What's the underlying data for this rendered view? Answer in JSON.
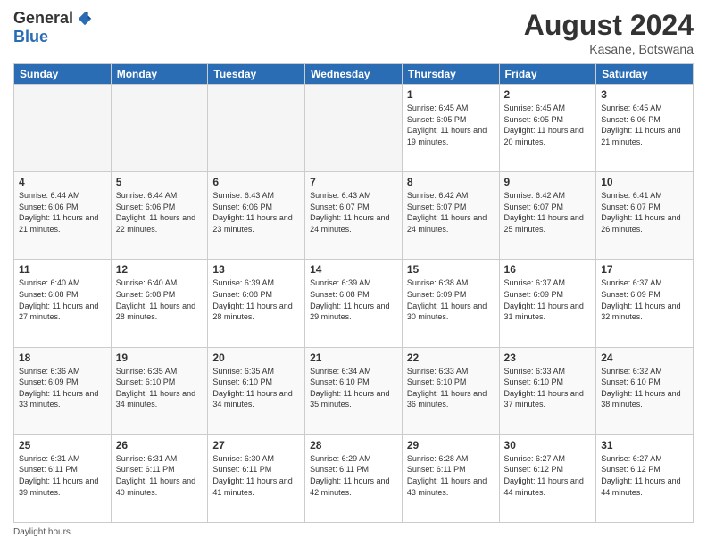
{
  "logo": {
    "general": "General",
    "blue": "Blue"
  },
  "title": "August 2024",
  "subtitle": "Kasane, Botswana",
  "days_of_week": [
    "Sunday",
    "Monday",
    "Tuesday",
    "Wednesday",
    "Thursday",
    "Friday",
    "Saturday"
  ],
  "footer": {
    "daylight_hours": "Daylight hours"
  },
  "weeks": [
    [
      {
        "day": "",
        "sunrise": "",
        "sunset": "",
        "daylight": "",
        "empty": true
      },
      {
        "day": "",
        "sunrise": "",
        "sunset": "",
        "daylight": "",
        "empty": true
      },
      {
        "day": "",
        "sunrise": "",
        "sunset": "",
        "daylight": "",
        "empty": true
      },
      {
        "day": "",
        "sunrise": "",
        "sunset": "",
        "daylight": "",
        "empty": true
      },
      {
        "day": "1",
        "sunrise": "Sunrise: 6:45 AM",
        "sunset": "Sunset: 6:05 PM",
        "daylight": "Daylight: 11 hours and 19 minutes.",
        "empty": false
      },
      {
        "day": "2",
        "sunrise": "Sunrise: 6:45 AM",
        "sunset": "Sunset: 6:05 PM",
        "daylight": "Daylight: 11 hours and 20 minutes.",
        "empty": false
      },
      {
        "day": "3",
        "sunrise": "Sunrise: 6:45 AM",
        "sunset": "Sunset: 6:06 PM",
        "daylight": "Daylight: 11 hours and 21 minutes.",
        "empty": false
      }
    ],
    [
      {
        "day": "4",
        "sunrise": "Sunrise: 6:44 AM",
        "sunset": "Sunset: 6:06 PM",
        "daylight": "Daylight: 11 hours and 21 minutes.",
        "empty": false
      },
      {
        "day": "5",
        "sunrise": "Sunrise: 6:44 AM",
        "sunset": "Sunset: 6:06 PM",
        "daylight": "Daylight: 11 hours and 22 minutes.",
        "empty": false
      },
      {
        "day": "6",
        "sunrise": "Sunrise: 6:43 AM",
        "sunset": "Sunset: 6:06 PM",
        "daylight": "Daylight: 11 hours and 23 minutes.",
        "empty": false
      },
      {
        "day": "7",
        "sunrise": "Sunrise: 6:43 AM",
        "sunset": "Sunset: 6:07 PM",
        "daylight": "Daylight: 11 hours and 24 minutes.",
        "empty": false
      },
      {
        "day": "8",
        "sunrise": "Sunrise: 6:42 AM",
        "sunset": "Sunset: 6:07 PM",
        "daylight": "Daylight: 11 hours and 24 minutes.",
        "empty": false
      },
      {
        "day": "9",
        "sunrise": "Sunrise: 6:42 AM",
        "sunset": "Sunset: 6:07 PM",
        "daylight": "Daylight: 11 hours and 25 minutes.",
        "empty": false
      },
      {
        "day": "10",
        "sunrise": "Sunrise: 6:41 AM",
        "sunset": "Sunset: 6:07 PM",
        "daylight": "Daylight: 11 hours and 26 minutes.",
        "empty": false
      }
    ],
    [
      {
        "day": "11",
        "sunrise": "Sunrise: 6:40 AM",
        "sunset": "Sunset: 6:08 PM",
        "daylight": "Daylight: 11 hours and 27 minutes.",
        "empty": false
      },
      {
        "day": "12",
        "sunrise": "Sunrise: 6:40 AM",
        "sunset": "Sunset: 6:08 PM",
        "daylight": "Daylight: 11 hours and 28 minutes.",
        "empty": false
      },
      {
        "day": "13",
        "sunrise": "Sunrise: 6:39 AM",
        "sunset": "Sunset: 6:08 PM",
        "daylight": "Daylight: 11 hours and 28 minutes.",
        "empty": false
      },
      {
        "day": "14",
        "sunrise": "Sunrise: 6:39 AM",
        "sunset": "Sunset: 6:08 PM",
        "daylight": "Daylight: 11 hours and 29 minutes.",
        "empty": false
      },
      {
        "day": "15",
        "sunrise": "Sunrise: 6:38 AM",
        "sunset": "Sunset: 6:09 PM",
        "daylight": "Daylight: 11 hours and 30 minutes.",
        "empty": false
      },
      {
        "day": "16",
        "sunrise": "Sunrise: 6:37 AM",
        "sunset": "Sunset: 6:09 PM",
        "daylight": "Daylight: 11 hours and 31 minutes.",
        "empty": false
      },
      {
        "day": "17",
        "sunrise": "Sunrise: 6:37 AM",
        "sunset": "Sunset: 6:09 PM",
        "daylight": "Daylight: 11 hours and 32 minutes.",
        "empty": false
      }
    ],
    [
      {
        "day": "18",
        "sunrise": "Sunrise: 6:36 AM",
        "sunset": "Sunset: 6:09 PM",
        "daylight": "Daylight: 11 hours and 33 minutes.",
        "empty": false
      },
      {
        "day": "19",
        "sunrise": "Sunrise: 6:35 AM",
        "sunset": "Sunset: 6:10 PM",
        "daylight": "Daylight: 11 hours and 34 minutes.",
        "empty": false
      },
      {
        "day": "20",
        "sunrise": "Sunrise: 6:35 AM",
        "sunset": "Sunset: 6:10 PM",
        "daylight": "Daylight: 11 hours and 34 minutes.",
        "empty": false
      },
      {
        "day": "21",
        "sunrise": "Sunrise: 6:34 AM",
        "sunset": "Sunset: 6:10 PM",
        "daylight": "Daylight: 11 hours and 35 minutes.",
        "empty": false
      },
      {
        "day": "22",
        "sunrise": "Sunrise: 6:33 AM",
        "sunset": "Sunset: 6:10 PM",
        "daylight": "Daylight: 11 hours and 36 minutes.",
        "empty": false
      },
      {
        "day": "23",
        "sunrise": "Sunrise: 6:33 AM",
        "sunset": "Sunset: 6:10 PM",
        "daylight": "Daylight: 11 hours and 37 minutes.",
        "empty": false
      },
      {
        "day": "24",
        "sunrise": "Sunrise: 6:32 AM",
        "sunset": "Sunset: 6:10 PM",
        "daylight": "Daylight: 11 hours and 38 minutes.",
        "empty": false
      }
    ],
    [
      {
        "day": "25",
        "sunrise": "Sunrise: 6:31 AM",
        "sunset": "Sunset: 6:11 PM",
        "daylight": "Daylight: 11 hours and 39 minutes.",
        "empty": false
      },
      {
        "day": "26",
        "sunrise": "Sunrise: 6:31 AM",
        "sunset": "Sunset: 6:11 PM",
        "daylight": "Daylight: 11 hours and 40 minutes.",
        "empty": false
      },
      {
        "day": "27",
        "sunrise": "Sunrise: 6:30 AM",
        "sunset": "Sunset: 6:11 PM",
        "daylight": "Daylight: 11 hours and 41 minutes.",
        "empty": false
      },
      {
        "day": "28",
        "sunrise": "Sunrise: 6:29 AM",
        "sunset": "Sunset: 6:11 PM",
        "daylight": "Daylight: 11 hours and 42 minutes.",
        "empty": false
      },
      {
        "day": "29",
        "sunrise": "Sunrise: 6:28 AM",
        "sunset": "Sunset: 6:11 PM",
        "daylight": "Daylight: 11 hours and 43 minutes.",
        "empty": false
      },
      {
        "day": "30",
        "sunrise": "Sunrise: 6:27 AM",
        "sunset": "Sunset: 6:12 PM",
        "daylight": "Daylight: 11 hours and 44 minutes.",
        "empty": false
      },
      {
        "day": "31",
        "sunrise": "Sunrise: 6:27 AM",
        "sunset": "Sunset: 6:12 PM",
        "daylight": "Daylight: 11 hours and 44 minutes.",
        "empty": false
      }
    ]
  ]
}
